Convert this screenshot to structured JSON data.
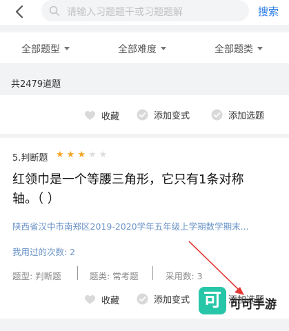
{
  "header": {
    "search_placeholder": "请输入习题题干或习题题解",
    "search_label": "搜索"
  },
  "filters": [
    {
      "label": "全部题型"
    },
    {
      "label": "全部难度"
    },
    {
      "label": "全部题类"
    }
  ],
  "total_label": "共2479道题",
  "actions": {
    "favorite": "收藏",
    "add_variant": "添加变式",
    "add_question": "添加选题"
  },
  "question": {
    "number_type": "5.判断题",
    "difficulty_stars": 3,
    "difficulty_max": 5,
    "stem": "红领巾是一个等腰三角形，它只有1条对称轴。（    ）",
    "source": "陕西省汉中市南郑区2019-2020学年五年级上学期数学期末...",
    "used_count": "我用过的次数: 2",
    "meta": {
      "type": "题型: 判断题",
      "category": "题类: 常考题",
      "adopt": "采用数: 3"
    }
  },
  "watermark": {
    "logo_char": "可",
    "text": "可可手游"
  },
  "colors": {
    "accent": "#2b7de9",
    "star_on": "#f5a623",
    "star_off": "#dddddd",
    "link_blue": "#6a93c7",
    "arrow_red": "#e53935"
  }
}
